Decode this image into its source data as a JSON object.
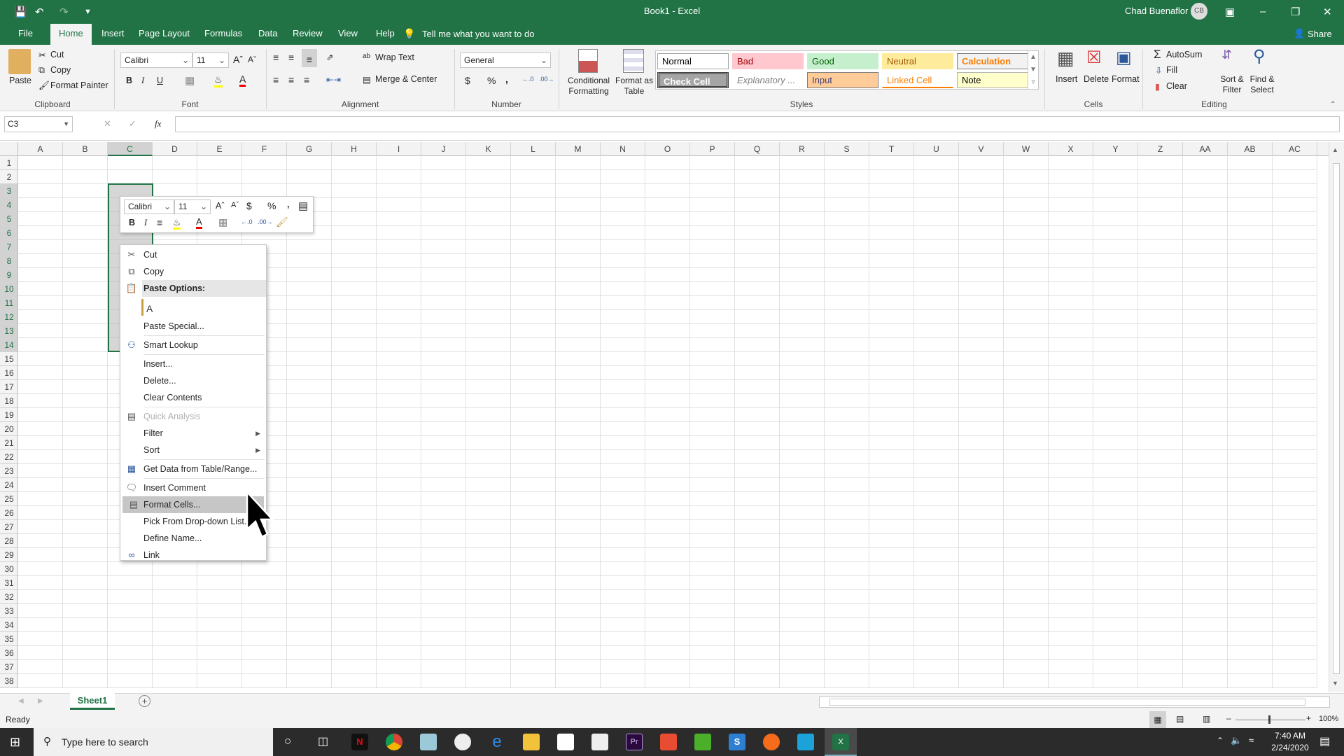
{
  "titlebar": {
    "title": "Book1 - Excel",
    "user": "Chad Buenaflor",
    "initials": "CB"
  },
  "tabs": [
    {
      "label": "File"
    },
    {
      "label": "Home"
    },
    {
      "label": "Insert"
    },
    {
      "label": "Page Layout"
    },
    {
      "label": "Formulas"
    },
    {
      "label": "Data"
    },
    {
      "label": "Review"
    },
    {
      "label": "View"
    },
    {
      "label": "Help"
    }
  ],
  "active_tab": "Home",
  "tell_me": "Tell me what you want to do",
  "share": "Share",
  "ribbon": {
    "clipboard": {
      "label": "Clipboard",
      "paste": "Paste",
      "cut": "Cut",
      "copy": "Copy",
      "format_painter": "Format Painter"
    },
    "font": {
      "label": "Font",
      "name": "Calibri",
      "size": "11",
      "bold": "B",
      "italic": "I",
      "underline": "U"
    },
    "alignment": {
      "label": "Alignment",
      "wrap": "Wrap Text",
      "merge": "Merge & Center"
    },
    "number": {
      "label": "Number",
      "format": "General",
      "currency": "$",
      "percent": "%",
      "comma": ","
    },
    "styles": {
      "label": "Styles",
      "conditional": "Conditional Formatting",
      "format_table": "Format as Table",
      "cells": [
        {
          "name": "Normal"
        },
        {
          "name": "Bad"
        },
        {
          "name": "Good"
        },
        {
          "name": "Neutral"
        },
        {
          "name": "Calculation"
        },
        {
          "name": "Check Cell"
        },
        {
          "name": "Explanatory ..."
        },
        {
          "name": "Input"
        },
        {
          "name": "Linked Cell"
        },
        {
          "name": "Note"
        }
      ]
    },
    "cells": {
      "label": "Cells",
      "insert": "Insert",
      "delete": "Delete",
      "format": "Format"
    },
    "editing": {
      "label": "Editing",
      "autosum": "AutoSum",
      "fill": "Fill",
      "clear": "Clear",
      "sort": "Sort & Filter",
      "find": "Find & Select"
    }
  },
  "formula_bar": {
    "name_box": "C3",
    "fx": "fx",
    "value": ""
  },
  "columns": [
    "A",
    "B",
    "C",
    "D",
    "E",
    "F",
    "G",
    "H",
    "I",
    "J",
    "K",
    "L",
    "M",
    "N",
    "O",
    "P",
    "Q",
    "R",
    "S",
    "T",
    "U",
    "V",
    "W",
    "X",
    "Y",
    "Z",
    "AA",
    "AB",
    "AC"
  ],
  "rows": [
    "1",
    "2",
    "3",
    "4",
    "5",
    "6",
    "7",
    "8",
    "9",
    "10",
    "11",
    "12",
    "13",
    "14",
    "15",
    "16",
    "17",
    "18",
    "19",
    "20",
    "21",
    "22",
    "23",
    "24",
    "25",
    "26",
    "27",
    "28",
    "29",
    "30",
    "31",
    "32",
    "33",
    "34",
    "35",
    "36",
    "37",
    "38"
  ],
  "selection": {
    "range": "C3:C14"
  },
  "mini_toolbar": {
    "font": "Calibri",
    "size": "11",
    "bold": "B",
    "italic": "I"
  },
  "context_menu": {
    "items": [
      {
        "label": "Cut",
        "icon": "scissors-icon"
      },
      {
        "label": "Copy",
        "icon": "copy-icon"
      },
      {
        "label": "Paste Options:",
        "icon": "paste-icon"
      },
      {
        "label": "Paste Special..."
      },
      {
        "label": "Smart Lookup",
        "icon": "search-icon"
      },
      {
        "label": "Insert..."
      },
      {
        "label": "Delete..."
      },
      {
        "label": "Clear Contents"
      },
      {
        "label": "Quick Analysis",
        "icon": "quick-analysis-icon",
        "disabled": true
      },
      {
        "label": "Filter",
        "submenu": true
      },
      {
        "label": "Sort",
        "submenu": true
      },
      {
        "label": "Get Data from Table/Range...",
        "icon": "table-icon"
      },
      {
        "label": "Insert Comment",
        "icon": "comment-icon"
      },
      {
        "label": "Format Cells...",
        "icon": "format-cells-icon",
        "highlighted": true
      },
      {
        "label": "Pick From Drop-down List..."
      },
      {
        "label": "Define Name..."
      },
      {
        "label": "Link",
        "icon": "link-icon"
      }
    ]
  },
  "sheets": [
    {
      "name": "Sheet1",
      "active": true
    }
  ],
  "status": {
    "text": "Ready",
    "zoom": "100%"
  },
  "taskbar": {
    "search": "Type here to search",
    "time": "7:40 AM",
    "date": "2/24/2020"
  },
  "colors": {
    "accent": "#217346"
  }
}
